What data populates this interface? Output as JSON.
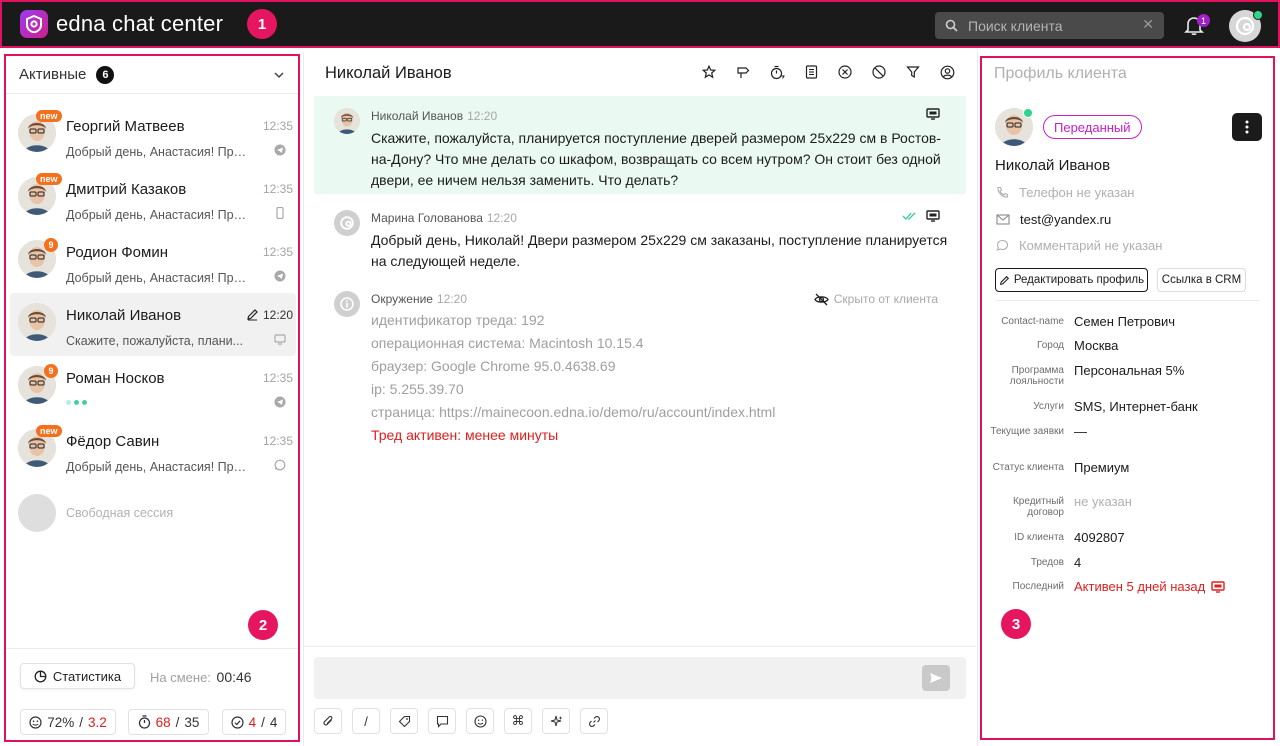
{
  "app": {
    "name": "edna chat center"
  },
  "callouts": [
    "1",
    "2",
    "3"
  ],
  "search": {
    "placeholder": "Поиск клиента"
  },
  "notifications": {
    "count": "1"
  },
  "sidebar": {
    "section_label": "Активные",
    "active_count": "6",
    "chats": [
      {
        "name": "Георгий Матвеев",
        "time": "12:35",
        "preview": "Добрый день, Анастасия! Пред...",
        "tag": "new",
        "channel": "telegram-icon"
      },
      {
        "name": "Дмитрий Казаков",
        "time": "12:35",
        "preview": "Добрый день, Анастасия! Пред...",
        "tag": "new",
        "channel": "mobile-icon"
      },
      {
        "name": "Родион Фомин",
        "time": "12:35",
        "preview": "Добрый день, Анастасия! Пред...",
        "tag": "9",
        "channel": "telegram-icon"
      },
      {
        "name": "Николай Иванов",
        "time": "12:20",
        "preview": "Скажите, пожалуйста, плани...",
        "tag": "",
        "channel": "webchat-icon"
      },
      {
        "name": "Роман Носков",
        "time": "12:35",
        "preview": "",
        "tag": "9",
        "channel": "telegram-icon"
      },
      {
        "name": "Фёдор Савин",
        "time": "12:35",
        "preview": "Добрый день, Анастасия! Пред...",
        "tag": "new",
        "channel": "whatsapp-icon"
      }
    ],
    "free_session": "Свободная сессия",
    "stats_button": "Статистика",
    "shift_label": "На смене:",
    "shift_time": "00:46",
    "metrics": {
      "csat_pct": "72%",
      "csat_sep": "/",
      "csat_score": "3.2",
      "time_a": "68",
      "time_sep": "/",
      "time_b": "35",
      "done_a": "4",
      "done_sep": "/",
      "done_b": "4"
    }
  },
  "conversation": {
    "title": "Николай Иванов",
    "messages": [
      {
        "author": "Николай Иванов",
        "time": "12:20",
        "text": "Скажите, пожалуйста, планируется поступление дверей размером 25х229 см в Ростов-на-Дону? Что мне делать со шкафом, возвращать со всем нутром? Он стоит без одной двери, ее ничем нельзя заменить. Что делать?"
      },
      {
        "author": "Марина Голованова",
        "time": "12:20",
        "text": "Добрый день, Николай! Двери размером 25х229 см заказаны, поступление планируется на следующей неделе."
      }
    ],
    "environment": {
      "author": "Окружение",
      "time": "12:20",
      "hidden_label": "Скрыто от клиента",
      "lines": [
        "идентификатор треда: 192",
        "операционная система: Macintosh 10.15.4",
        "браузер: Google Chrome 95.0.4638.69",
        "ip: 5.255.39.70",
        "страница: https://mainecoon.edna.io/demo/ru/account/index.html"
      ],
      "status_line": "Тред активен: менее минуты"
    },
    "composer_tools": [
      "attach-icon",
      "slash-command-icon",
      "tag-icon",
      "comment-icon",
      "emoji-icon",
      "command-icon",
      "ai-sparkle-icon",
      "link-icon"
    ]
  },
  "profile": {
    "title": "Профиль клиента",
    "status_badge": "Переданный",
    "name": "Николай Иванов",
    "phone": "Телефон не указан",
    "email": "test@yandex.ru",
    "comment": "Комментарий не указан",
    "edit_button": "Редактировать профиль",
    "crm_button": "Ссылка в CRM",
    "fields": [
      {
        "key": "Contact-name",
        "value": "Семен Петрович"
      },
      {
        "key": "Город",
        "value": "Москва"
      },
      {
        "key": "Программа лояльности",
        "value": "Персональная 5%"
      },
      {
        "key": "Услуги",
        "value": "SMS, Интернет-банк"
      },
      {
        "key": "Текущие заявки",
        "value": "—"
      },
      {
        "key": "Статус клиента",
        "value": "Премиум"
      },
      {
        "key": "Кредитный договор",
        "value": "не указан"
      },
      {
        "key": "ID клиента",
        "value": "4092807"
      },
      {
        "key": "Тредов",
        "value": "4"
      },
      {
        "key": "Последний",
        "value": "Активен 5 дней назад"
      }
    ]
  },
  "colors": {
    "accent": "#e0115f",
    "transferred": "#c720c9",
    "unread": "#f4701c",
    "client_bg": "#eaf9f1",
    "alert": "#e01e1e"
  }
}
